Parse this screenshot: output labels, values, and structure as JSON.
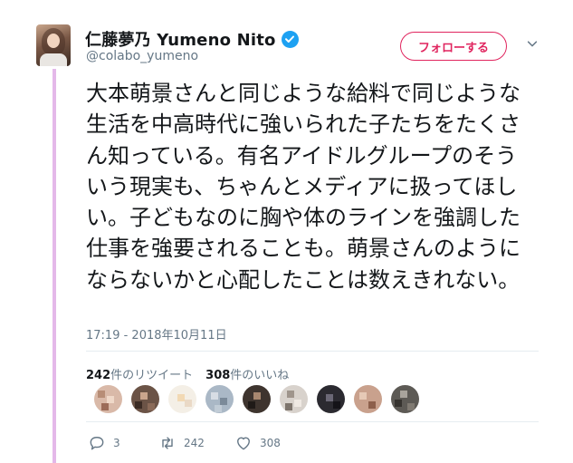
{
  "user": {
    "display_name": "仁藤夢乃 Yumeno Nito",
    "handle": "@colabo_yumeno",
    "follow_label": "フォローする"
  },
  "tweet": {
    "text": "大本萌景さんと同じような給料で同じような生活を中高時代に強いられた子たちをたくさん知っている。有名アイドルグループのそういう現実も、ちゃんとメディアに扱ってほしい。子どもなのに胸や体のラインを強調した仕事を強要されることも。萌景さんのようにならないかと心配したことは数えきれない。",
    "timestamp": "17:19 - 2018年10月11日"
  },
  "stats": {
    "retweets_count": "242",
    "retweets_label": "件のリツイート",
    "likes_count": "308",
    "likes_label": "件のいいね"
  },
  "actions": {
    "reply_count": "3",
    "retweet_count": "242",
    "like_count": "308"
  },
  "colors": {
    "accent": "#e0245e",
    "verified": "#1da1f2",
    "thread_line": "#e4b8e9",
    "muted_text": "#657786"
  },
  "icons": [
    "verified-badge-icon",
    "chevron-down-icon",
    "reply-icon",
    "retweet-icon",
    "heart-icon"
  ]
}
